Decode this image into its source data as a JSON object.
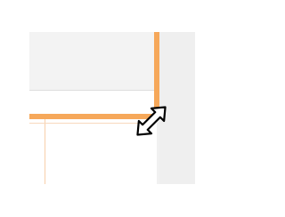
{
  "colors": {
    "selection_edge": "#f6a85a",
    "guide_line": "#f8cfaa",
    "workspace": "#f1f1f1",
    "window_background": "#ffffff",
    "cursor_fill": "#ffffff",
    "cursor_stroke": "#000000"
  },
  "cursor": {
    "icon": "diagonal-resize-cursor-icon"
  }
}
